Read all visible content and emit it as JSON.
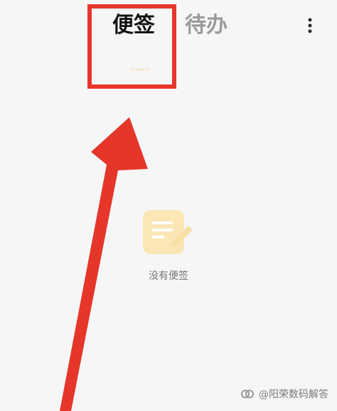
{
  "tabs": {
    "notes_label": "便签",
    "todo_label": "待办"
  },
  "toolbar": {
    "more_icon": "more-vertical-icon"
  },
  "empty_state": {
    "icon": "note-empty-icon",
    "message": "没有便签"
  },
  "annotation": {
    "highlight_color": "#e6362a",
    "arrow_color": "#e6362a"
  },
  "watermark": {
    "logo_name": "watermark-logo",
    "text": "@阳荣数码解答"
  },
  "colors": {
    "background": "#f6f6f6",
    "active_tab": "#141414",
    "inactive_tab": "#9a9a9a",
    "empty_icon": "#fbe7b6"
  }
}
